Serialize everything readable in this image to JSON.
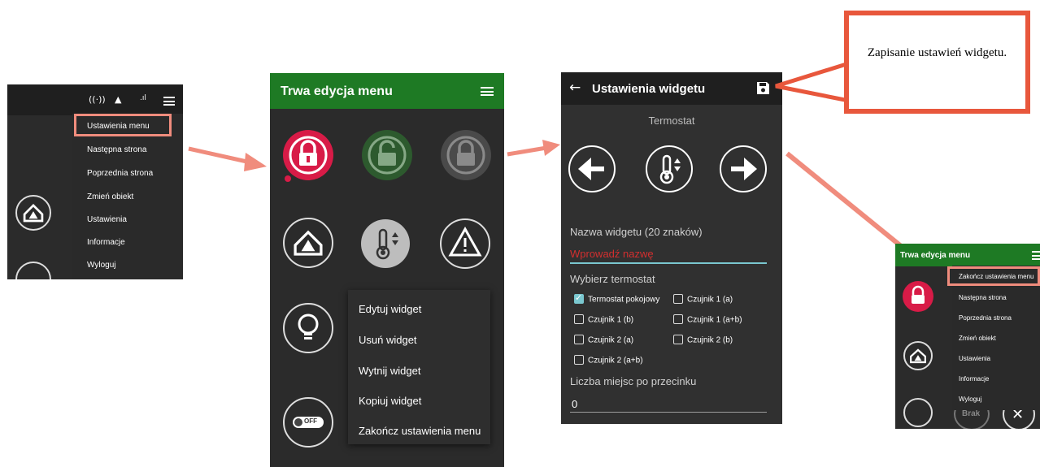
{
  "screen1": {
    "menu_items": [
      "Ustawienia menu",
      "Następna strona",
      "Poprzednia strona",
      "Zmień obiekt",
      "Ustawienia",
      "Informacje",
      "Wyloguj"
    ]
  },
  "screen2": {
    "title": "Trwa edycja menu",
    "context_menu": [
      "Edytuj widget",
      "Usuń widget",
      "Wytnij widget",
      "Kopiuj widget",
      "Zakończ ustawienia menu"
    ],
    "off_label": "OFF"
  },
  "screen3": {
    "title": "Ustawienia widgetu",
    "subtitle": "Termostat",
    "name_label": "Nazwa widgetu (20 znaków)",
    "name_placeholder": "Wprowadź nazwę",
    "select_label": "Wybierz termostat",
    "checkboxes": [
      {
        "label": "Termostat pokojowy",
        "checked": true
      },
      {
        "label": "Czujnik 1 (a)",
        "checked": false
      },
      {
        "label": "Czujnik 1 (b)",
        "checked": false
      },
      {
        "label": "Czujnik 1 (a+b)",
        "checked": false
      },
      {
        "label": "Czujnik 2 (a)",
        "checked": false
      },
      {
        "label": "Czujnik 2 (b)",
        "checked": false
      },
      {
        "label": "Czujnik 2 (a+b)",
        "checked": false
      }
    ],
    "decimals_label": "Liczba miejsc po przecinku",
    "decimals_value": "0"
  },
  "callout": {
    "text": "Zapisanie ustawień widgetu."
  },
  "screen4": {
    "title": "Trwa edycja menu",
    "menu_items": [
      "Zakończ ustawienia menu",
      "Następna strona",
      "Poprzednia strona",
      "Zmień obiekt",
      "Ustawienia",
      "Informacje",
      "Wyloguj"
    ],
    "brak_label": "Brak"
  },
  "colors": {
    "green_bar": "#1e7a24",
    "highlight": "#f08c7d",
    "callout_border": "#e8573c",
    "accent_red": "#d81b47",
    "arrow": "#f08c7d"
  }
}
